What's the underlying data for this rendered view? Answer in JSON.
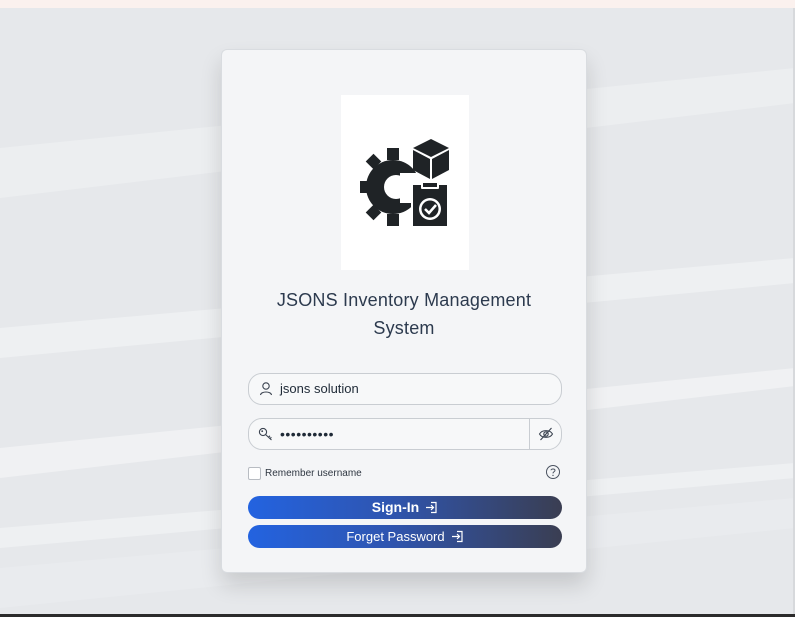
{
  "app": {
    "title_line1": "JSONS Inventory Management",
    "title_line2": "System",
    "logo_icon": "gear-box-clipboard-icon"
  },
  "login": {
    "username_value": "jsons solution",
    "username_icon": "user-icon",
    "password_value": "••••••••••",
    "password_icon": "key-icon",
    "toggle_icon": "eye-slash-icon",
    "remember_label": "Remember username",
    "help_icon": "question-circle-icon"
  },
  "actions": {
    "signin_label": "Sign-In",
    "forget_label": "Forget Password",
    "action_icon": "sign-in-arrow-icon"
  },
  "colors": {
    "button_gradient_start": "#2363e0",
    "button_gradient_end": "#3a3e52",
    "title_color": "#2c3a4e"
  }
}
